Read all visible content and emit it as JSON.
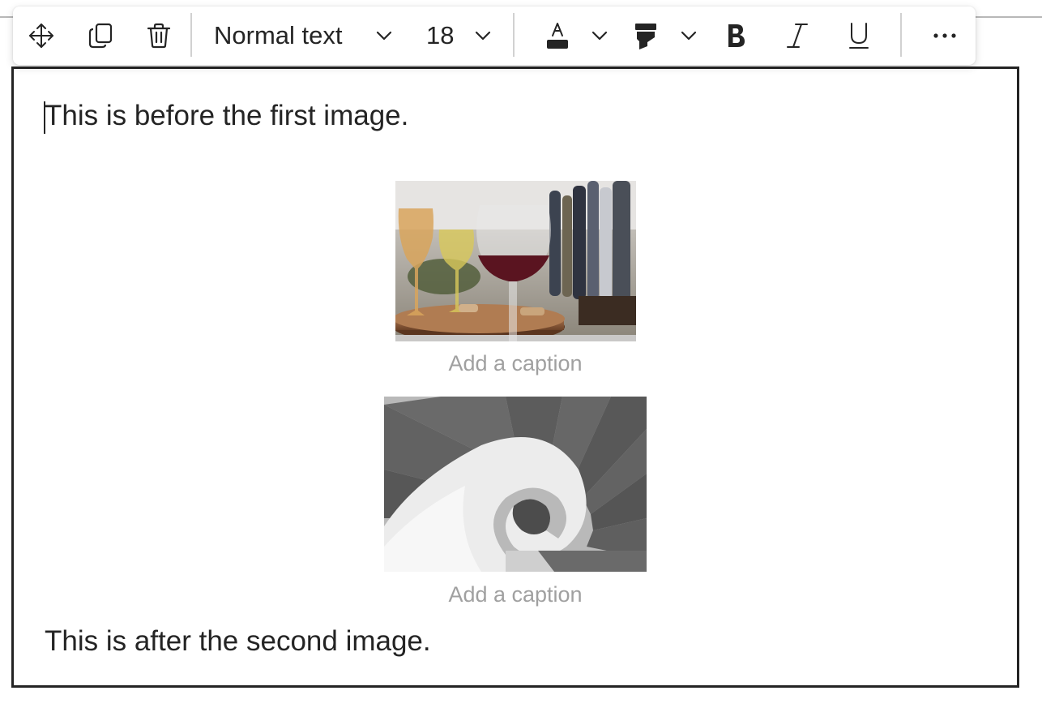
{
  "toolbar": {
    "move_icon": "move-arrows-icon",
    "copy_icon": "copy-icon",
    "delete_icon": "trash-icon",
    "style_select": {
      "value": "Normal text"
    },
    "size_select": {
      "value": "18"
    },
    "font_color_icon": "font-color-icon",
    "highlight_icon": "highlighter-icon",
    "bold_icon": "bold-icon",
    "italic_icon": "italic-icon",
    "underline_icon": "underline-icon",
    "more_icon": "more-options-icon"
  },
  "editor": {
    "first_paragraph": "This is before the first image.",
    "images": [
      {
        "subject": "wine glasses and bottles",
        "caption_placeholder": "Add a caption"
      },
      {
        "subject": "spiral staircase",
        "caption_placeholder": "Add a caption"
      }
    ],
    "last_paragraph": "This is after the second image."
  },
  "colors": {
    "text": "#242424",
    "caption_placeholder": "#a0a0a0",
    "editor_border": "#242424",
    "separator": "#d1d1d1"
  }
}
